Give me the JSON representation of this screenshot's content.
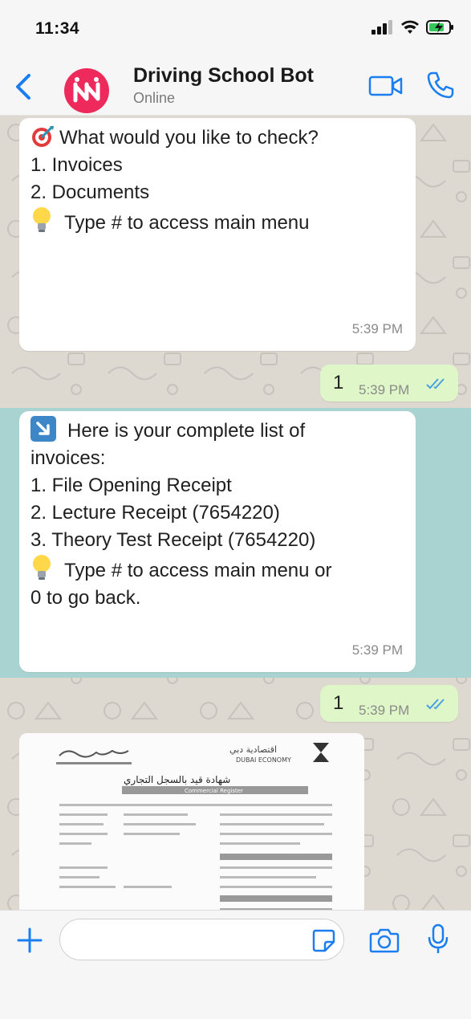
{
  "status_bar": {
    "time": "11:34"
  },
  "header": {
    "title": "Driving School Bot",
    "subtitle": "Online"
  },
  "messages": [
    {
      "direction": "incoming",
      "lines": [
        "What would you like to check?",
        "",
        "1. Invoices",
        "2. Documents",
        "",
        "",
        "Type # to access main menu"
      ],
      "time": "5:39 PM"
    },
    {
      "direction": "outgoing",
      "text": "1",
      "time": "5:39 PM",
      "status": "read"
    },
    {
      "direction": "incoming",
      "lines": [
        "Here is your complete list of",
        "invoices:",
        "",
        "1. File Opening Receipt",
        "2. Lecture Receipt (7654220)",
        "3. Theory Test Receipt (7654220)",
        "",
        "Type # to access main menu or",
        "0 to go back."
      ],
      "time": "5:39 PM"
    },
    {
      "direction": "outgoing",
      "text": "1",
      "time": "5:39 PM",
      "status": "read"
    },
    {
      "direction": "incoming",
      "type": "image",
      "document": {
        "header_english": "DUBAI ECONOMY",
        "subheader": "Commercial Register"
      }
    }
  ],
  "input": {
    "placeholder": "",
    "value": ""
  },
  "colors": {
    "accent": "#1a7ef0",
    "avatar": "#ee2a5c",
    "outgoing_bubble": "#dff7c8",
    "chat_background": "#ddd8d0",
    "highlight_band": "#a9d3d1",
    "read_ticks": "#4a9fe0"
  }
}
